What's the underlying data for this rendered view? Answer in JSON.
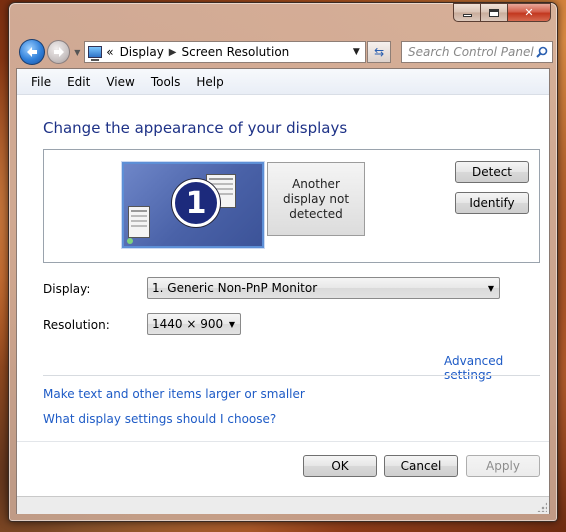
{
  "window": {
    "caption_buttons": {
      "minimize": "minimize",
      "maximize": "maximize",
      "close": "✕"
    }
  },
  "nav": {
    "address": {
      "overflow": "«",
      "crumbs": [
        "Display",
        "Screen Resolution"
      ]
    },
    "search_placeholder": "Search Control Panel"
  },
  "menu": [
    "File",
    "Edit",
    "View",
    "Tools",
    "Help"
  ],
  "main": {
    "title": "Change the appearance of your displays",
    "monitor_primary_number": "1",
    "monitor_secondary_text": "Another display not detected",
    "detect_label": "Detect",
    "identify_label": "Identify",
    "display_label": "Display:",
    "display_value": "1. Generic Non-PnP Monitor",
    "resolution_label": "Resolution:",
    "resolution_value": "1440 × 900",
    "advanced_link": "Advanced settings",
    "link_text_size": "Make text and other items larger or smaller",
    "link_which_settings": "What display settings should I choose?"
  },
  "footer": {
    "ok_label": "OK",
    "cancel_label": "Cancel",
    "apply_label": "Apply",
    "apply_enabled": false
  },
  "colors": {
    "link": "#1e5bc6",
    "title": "#1e3287",
    "monitor_selected": "#4a62a8"
  }
}
